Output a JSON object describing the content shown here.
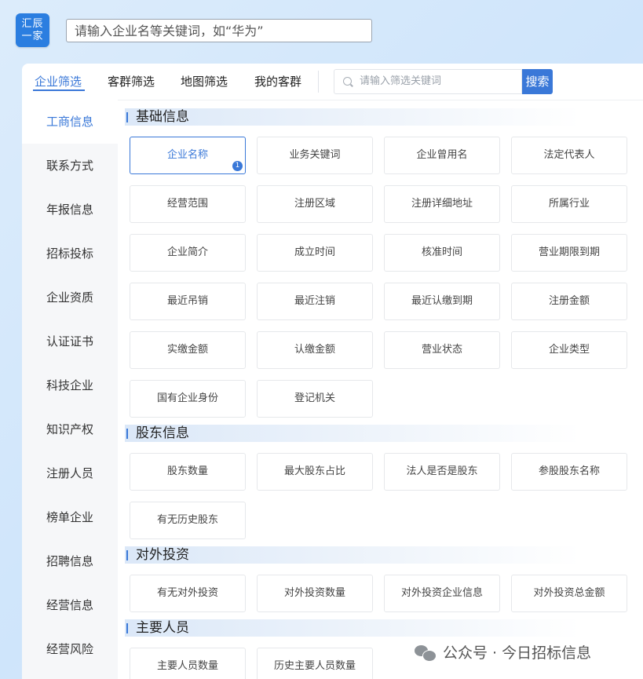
{
  "header": {
    "logo_line1": "汇辰",
    "logo_line2": "一家",
    "search_placeholder": "请输入企业名等关键词，如“华为”"
  },
  "tabs": [
    {
      "label": "企业筛选",
      "active": true
    },
    {
      "label": "客群筛选",
      "active": false
    },
    {
      "label": "地图筛选",
      "active": false
    },
    {
      "label": "我的客群",
      "active": false
    }
  ],
  "filter_search": {
    "placeholder": "请输入筛选关键词",
    "button_label": "搜索"
  },
  "sidebar": {
    "items": [
      {
        "label": "工商信息",
        "active": true
      },
      {
        "label": "联系方式"
      },
      {
        "label": "年报信息"
      },
      {
        "label": "招标投标"
      },
      {
        "label": "企业资质"
      },
      {
        "label": "认证证书"
      },
      {
        "label": "科技企业"
      },
      {
        "label": "知识产权"
      },
      {
        "label": "注册人员"
      },
      {
        "label": "榜单企业"
      },
      {
        "label": "招聘信息"
      },
      {
        "label": "经营信息"
      },
      {
        "label": "经营风险"
      }
    ]
  },
  "sections": [
    {
      "title": "基础信息",
      "items": [
        "企业名称",
        "业务关键词",
        "企业曾用名",
        "法定代表人",
        "经营范围",
        "注册区域",
        "注册详细地址",
        "所属行业",
        "企业简介",
        "成立时间",
        "核准时间",
        "营业期限到期",
        "最近吊销",
        "最近注销",
        "最近认缴到期",
        "注册金额",
        "实缴金额",
        "认缴金额",
        "营业状态",
        "企业类型",
        "国有企业身份",
        "登记机关"
      ],
      "selected_badge": "1"
    },
    {
      "title": "股东信息",
      "items": [
        "股东数量",
        "最大股东占比",
        "法人是否是股东",
        "参股股东名称",
        "有无历史股东"
      ]
    },
    {
      "title": "对外投资",
      "items": [
        "有无对外投资",
        "对外投资数量",
        "对外投资企业信息",
        "对外投资总金额"
      ]
    },
    {
      "title": "主要人员",
      "items": [
        "主要人员数量",
        "历史主要人员数量"
      ]
    }
  ],
  "watermark": "公众号 · 今日招标信息",
  "colors": {
    "accent": "#3a78d8",
    "sidebar_bg": "#f6f7f9"
  }
}
